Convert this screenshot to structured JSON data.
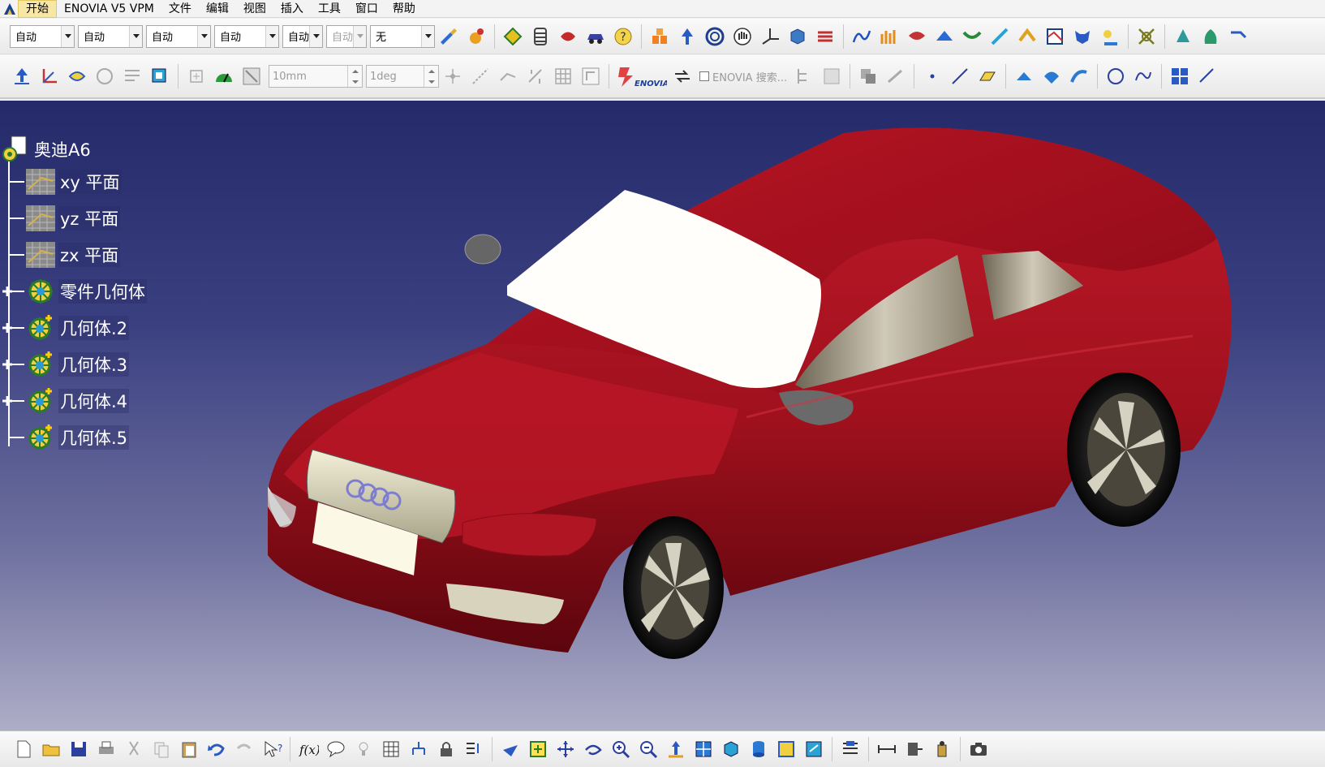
{
  "menubar": {
    "items": [
      "开始",
      "ENOVIA V5 VPM",
      "文件",
      "编辑",
      "视图",
      "插入",
      "工具",
      "窗口",
      "帮助"
    ]
  },
  "toolbar1": {
    "combos": [
      "自动",
      "自动",
      "自动",
      "自动",
      "自动",
      "自动",
      "无"
    ]
  },
  "toolbar2": {
    "length_field": "10mm",
    "angle_field": "1deg",
    "enovia_search_label": "ENOVIA 搜索...",
    "enovia_logo_text": "ENOVIA"
  },
  "tree": {
    "root": "奥迪A6",
    "nodes": [
      {
        "label": "xy 平面",
        "icon": "plane-icon",
        "expandable": false
      },
      {
        "label": "yz 平面",
        "icon": "plane-icon",
        "expandable": false
      },
      {
        "label": "zx 平面",
        "icon": "plane-icon",
        "expandable": false
      },
      {
        "label": "零件几何体",
        "icon": "part-body-icon",
        "expandable": true
      },
      {
        "label": "几何体.2",
        "icon": "body-icon",
        "expandable": true
      },
      {
        "label": "几何体.3",
        "icon": "body-icon",
        "expandable": true
      },
      {
        "label": "几何体.4",
        "icon": "body-icon",
        "expandable": true
      },
      {
        "label": "几何体.5",
        "icon": "body-icon",
        "expandable": false
      }
    ]
  },
  "colors": {
    "car_body": "#a0111d",
    "viewport_top": "#242a6a",
    "viewport_bottom": "#aeadc7"
  }
}
